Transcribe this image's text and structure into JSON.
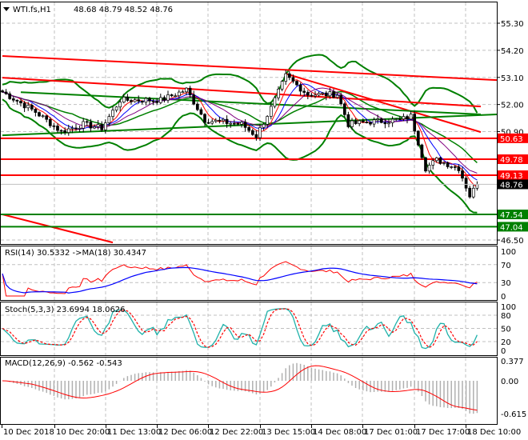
{
  "header": {
    "symbol": "WTI.fs,H1",
    "ohlc": "48.68 48.79 48.52 48.76"
  },
  "colors": {
    "level_red": "#ff0000",
    "level_green": "#008000",
    "bands": "#008000",
    "current": "#000000"
  },
  "main_axis": {
    "labels": [
      "55.30",
      "54.20",
      "53.10",
      "52.00",
      "50.90",
      "46.50"
    ]
  },
  "levels": [
    {
      "price": "50.63",
      "color": "#ff0000"
    },
    {
      "price": "49.78",
      "color": "#ff0000"
    },
    {
      "price": "49.13",
      "color": "#ff0000"
    },
    {
      "price": "47.54",
      "color": "#008000"
    },
    {
      "price": "47.04",
      "color": "#008000"
    }
  ],
  "current_price": "48.76",
  "rsi": {
    "label": "RSI(14) 30.5332  ->MA(18) 30.4347",
    "axis": [
      "100",
      "70",
      "30",
      "0"
    ]
  },
  "stoch": {
    "label": "Stoch(5,3,3) 23.6994 18.0626",
    "axis": [
      "100",
      "80",
      "50",
      "20",
      "0"
    ]
  },
  "macd": {
    "label": "MACD(12,26,9) -0.562 -0.543",
    "axis": [
      "0.377",
      "0.00",
      "-0.615"
    ]
  },
  "time_axis": [
    "10 Dec 2018",
    "10 Dec 20:00",
    "11 Dec 13:00",
    "12 Dec 06:00",
    "12 Dec 22:00",
    "13 Dec 15:00",
    "14 Dec 08:00",
    "17 Dec 01:00",
    "17 Dec 17:00",
    "18 Dec 10:00"
  ],
  "chart_data": {
    "type": "candlestick",
    "bars": 130,
    "price_path": [
      [
        0,
        52.51
      ],
      [
        9,
        51.7
      ],
      [
        16,
        50.9
      ],
      [
        22,
        51.2
      ],
      [
        27,
        51.05
      ],
      [
        32,
        52.18
      ],
      [
        43,
        52.18
      ],
      [
        50,
        52.6
      ],
      [
        55,
        51.37
      ],
      [
        65,
        51.2
      ],
      [
        69,
        50.72
      ],
      [
        73,
        51.86
      ],
      [
        77,
        53.16
      ],
      [
        83,
        52.41
      ],
      [
        91,
        52.41
      ],
      [
        94,
        51.2
      ],
      [
        100,
        51.3
      ],
      [
        108,
        51.37
      ],
      [
        111,
        51.53
      ],
      [
        115,
        49.42
      ],
      [
        118,
        49.75
      ],
      [
        124,
        49.42
      ],
      [
        127,
        48.3
      ],
      [
        129,
        48.76
      ]
    ],
    "trendlines": [
      {
        "color": "#ff0000",
        "from": [
          0,
          53.97
        ],
        "to": [
          135,
          52.99
        ]
      },
      {
        "color": "#ff0000",
        "from": [
          0,
          53.09
        ],
        "to": [
          130,
          51.92
        ]
      },
      {
        "color": "#ff0000",
        "from": [
          77,
          53.25
        ],
        "to": [
          130,
          50.88
        ]
      },
      {
        "color": "#ff0000",
        "from": [
          0,
          47.54
        ],
        "to": [
          30,
          46.4
        ]
      },
      {
        "color": "#008000",
        "from": [
          0,
          50.75
        ],
        "to": [
          135,
          51.6
        ]
      },
      {
        "color": "#008000",
        "from": [
          5,
          52.5
        ],
        "to": [
          130,
          51.6
        ]
      }
    ],
    "ylim": [
      46.5,
      55.3
    ]
  }
}
